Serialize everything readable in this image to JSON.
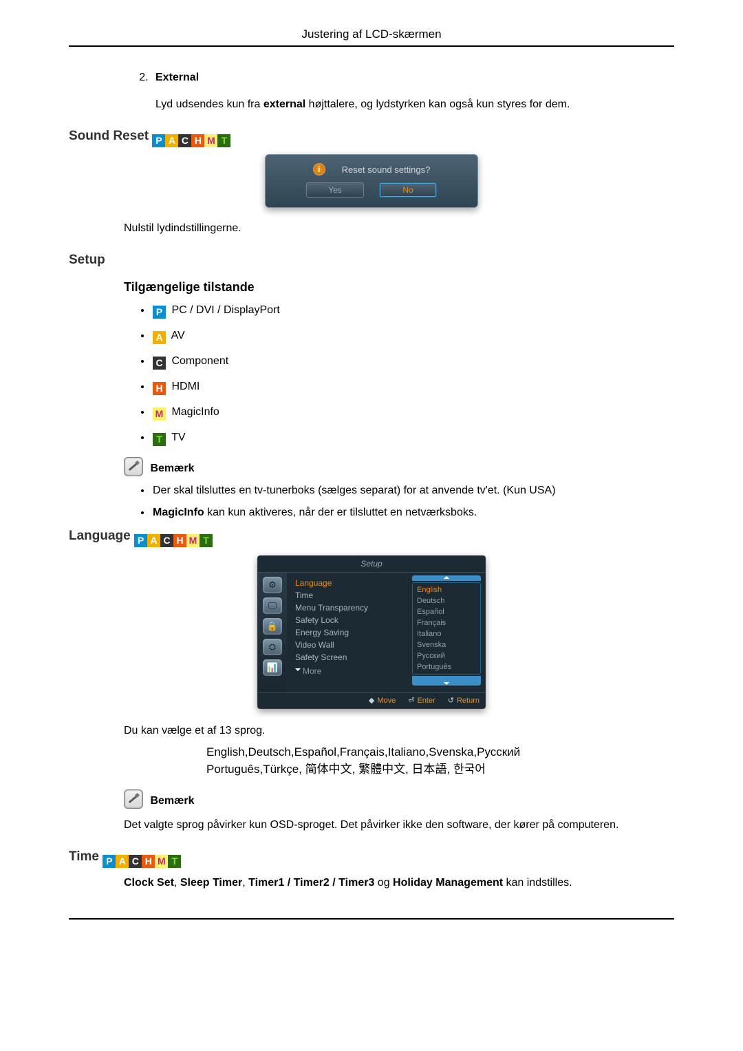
{
  "page_header": "Justering af LCD-skærmen",
  "external_item_num": "2.",
  "external_item_label": "External",
  "external_p_before": "Lyd udsendes kun fra ",
  "external_p_bold": "external",
  "external_p_after": " højttalere, og lydstyrken kan også kun styres for dem.",
  "sound_reset_title": "Sound Reset",
  "sound_reset_dialog": {
    "info_glyph": "i",
    "question": "Reset sound settings?",
    "yes": "Yes",
    "no": "No"
  },
  "sound_reset_desc": "Nulstil lydindstillingerne.",
  "setup_title": "Setup",
  "available_modes_title": "Tilgængelige tilstande",
  "badges": {
    "P": "P",
    "A": "A",
    "C": "C",
    "H": "H",
    "M": "M",
    "T": "T"
  },
  "modes": {
    "pc": "PC / DVI / DisplayPort",
    "av": "AV",
    "component": "Component",
    "hdmi": "HDMI",
    "magicinfo": "MagicInfo",
    "tv": "TV"
  },
  "note_label": "Bemærk",
  "notes_setup": {
    "tuner": "Der skal tilsluttes en tv-tunerboks (sælges separat) for at anvende tv'et. (Kun USA)",
    "magic_before": "MagicInfo",
    "magic_after": " kan kun aktiveres, når der er tilsluttet en netværksboks."
  },
  "language_title": "Language",
  "osd_menu": {
    "title": "Setup",
    "side_icons": [
      "⚙",
      "🖵",
      "🔒",
      "⛭",
      "📊"
    ],
    "items": {
      "language": "Language",
      "time": "Time",
      "transparency": "Menu Transparency",
      "safety_lock": "Safety Lock",
      "energy": "Energy Saving",
      "video_wall": "Video Wall",
      "safety_screen": "Safety Screen",
      "more": "More"
    },
    "values": {
      "english": "English",
      "deutsch": "Deutsch",
      "espanol": "Español",
      "francais": "Français",
      "italiano": "Italiano",
      "svenska": "Svenska",
      "russkij": "Русский",
      "portugues": "Português"
    },
    "footer": {
      "move": "Move",
      "enter": "Enter",
      "return": "Return"
    }
  },
  "lang_desc": "Du kan vælge et af 13 sprog.",
  "lang_list_line1": "English,Deutsch,Español,Français,Italiano,Svenska,Русский",
  "lang_list_line2": "Português,Türkçe, 简体中文, 繁體中文, 日本語, 한국어",
  "lang_note": "Det valgte sprog påvirker kun OSD-sproget. Det påvirker ikke den software, der kører på computeren.",
  "time_title": "Time",
  "time_desc": {
    "clock_set": "Clock Set",
    "sleep_timer": "Sleep Timer",
    "timers": "Timer1 / Timer2 / Timer3",
    "and": " og ",
    "holiday": "Holiday Management",
    "tail": " kan indstilles."
  }
}
